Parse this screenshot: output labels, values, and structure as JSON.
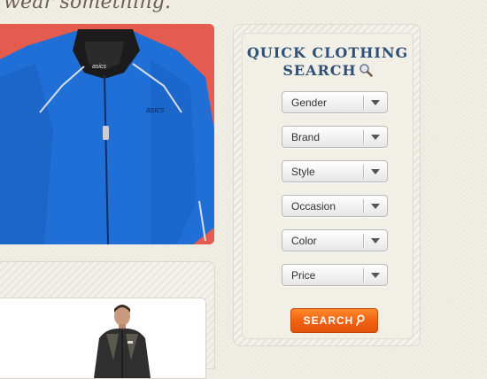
{
  "tagline": "wear something.",
  "quick_search": {
    "title_line1": "QUICK CLOTHING",
    "title_line2": "SEARCH",
    "filters": [
      {
        "label": "Gender"
      },
      {
        "label": "Brand"
      },
      {
        "label": "Style"
      },
      {
        "label": "Occasion"
      },
      {
        "label": "Color"
      },
      {
        "label": "Price"
      }
    ],
    "search_label": "SEARCH"
  },
  "featured_product": {
    "brand_mark": "asics",
    "jacket_color": "#1f6fd6",
    "background_color": "#e45b4f"
  },
  "colors": {
    "title": "#2f5177",
    "button": "#f06010"
  }
}
